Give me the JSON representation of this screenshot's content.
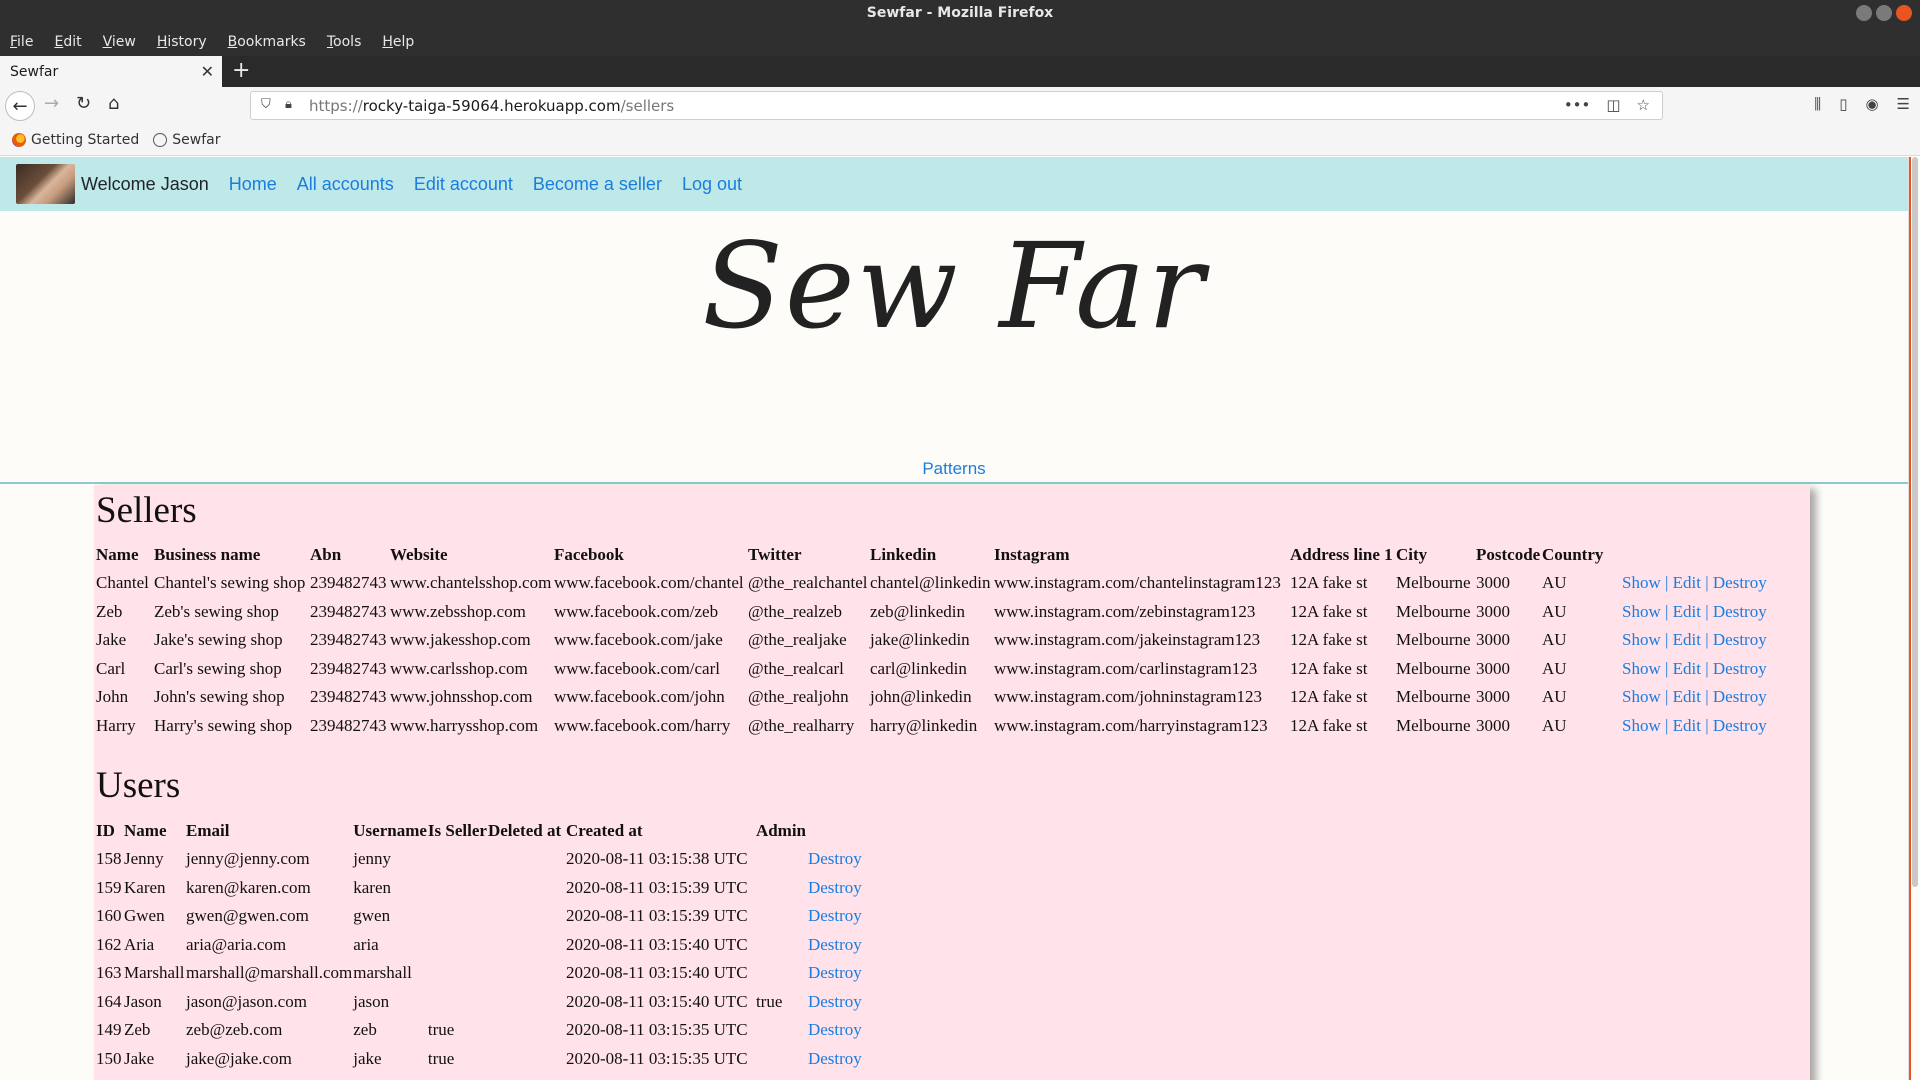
{
  "window": {
    "title": "Sewfar - Mozilla Firefox"
  },
  "menu": [
    "File",
    "Edit",
    "View",
    "History",
    "Bookmarks",
    "Tools",
    "Help"
  ],
  "tab": {
    "title": "Sewfar"
  },
  "url": {
    "prefix": "https://",
    "host": "rocky-taiga-59064.herokuapp.com",
    "path": "/sellers"
  },
  "bookmarks": [
    "Getting Started",
    "Sewfar"
  ],
  "site_nav": {
    "welcome": "Welcome Jason",
    "links": [
      "Home",
      "All accounts",
      "Edit account",
      "Become a seller",
      "Log out"
    ]
  },
  "brand": "Sew Far",
  "patterns_link": "Patterns",
  "sellers": {
    "heading": "Sellers",
    "columns": [
      "Name",
      "Business name",
      "Abn",
      "Website",
      "Facebook",
      "Twitter",
      "Linkedin",
      "Instagram",
      "Address line 1",
      "City",
      "Postcode",
      "Country"
    ],
    "actions": [
      "Show",
      "Edit",
      "Destroy"
    ],
    "rows": [
      [
        "Chantel",
        "Chantel's sewing shop",
        "239482743",
        "www.chantelsshop.com",
        "www.facebook.com/chantel",
        "@the_realchantel",
        "chantel@linkedin",
        "www.instagram.com/chantelinstagram123",
        "12A fake st",
        "Melbourne",
        "3000",
        "AU"
      ],
      [
        "Zeb",
        "Zeb's sewing shop",
        "239482743",
        "www.zebsshop.com",
        "www.facebook.com/zeb",
        "@the_realzeb",
        "zeb@linkedin",
        "www.instagram.com/zebinstagram123",
        "12A fake st",
        "Melbourne",
        "3000",
        "AU"
      ],
      [
        "Jake",
        "Jake's sewing shop",
        "239482743",
        "www.jakesshop.com",
        "www.facebook.com/jake",
        "@the_realjake",
        "jake@linkedin",
        "www.instagram.com/jakeinstagram123",
        "12A fake st",
        "Melbourne",
        "3000",
        "AU"
      ],
      [
        "Carl",
        "Carl's sewing shop",
        "239482743",
        "www.carlsshop.com",
        "www.facebook.com/carl",
        "@the_realcarl",
        "carl@linkedin",
        "www.instagram.com/carlinstagram123",
        "12A fake st",
        "Melbourne",
        "3000",
        "AU"
      ],
      [
        "John",
        "John's sewing shop",
        "239482743",
        "www.johnsshop.com",
        "www.facebook.com/john",
        "@the_realjohn",
        "john@linkedin",
        "www.instagram.com/johninstagram123",
        "12A fake st",
        "Melbourne",
        "3000",
        "AU"
      ],
      [
        "Harry",
        "Harry's sewing shop",
        "239482743",
        "www.harrysshop.com",
        "www.facebook.com/harry",
        "@the_realharry",
        "harry@linkedin",
        "www.instagram.com/harryinstagram123",
        "12A fake st",
        "Melbourne",
        "3000",
        "AU"
      ]
    ]
  },
  "users": {
    "heading": "Users",
    "columns": [
      "ID",
      "Name",
      "Email",
      "Username",
      "Is Seller",
      "Deleted at",
      "Created at",
      "Admin"
    ],
    "action": "Destroy",
    "rows": [
      [
        "158",
        "Jenny",
        "jenny@jenny.com",
        "jenny",
        "",
        "",
        "2020-08-11 03:15:38 UTC",
        ""
      ],
      [
        "159",
        "Karen",
        "karen@karen.com",
        "karen",
        "",
        "",
        "2020-08-11 03:15:39 UTC",
        ""
      ],
      [
        "160",
        "Gwen",
        "gwen@gwen.com",
        "gwen",
        "",
        "",
        "2020-08-11 03:15:39 UTC",
        ""
      ],
      [
        "162",
        "Aria",
        "aria@aria.com",
        "aria",
        "",
        "",
        "2020-08-11 03:15:40 UTC",
        ""
      ],
      [
        "163",
        "Marshall",
        "marshall@marshall.com",
        "marshall",
        "",
        "",
        "2020-08-11 03:15:40 UTC",
        ""
      ],
      [
        "164",
        "Jason",
        "jason@jason.com",
        "jason",
        "",
        "",
        "2020-08-11 03:15:40 UTC",
        "true"
      ],
      [
        "149",
        "Zeb",
        "zeb@zeb.com",
        "zeb",
        "true",
        "",
        "2020-08-11 03:15:35 UTC",
        ""
      ],
      [
        "150",
        "Jake",
        "jake@jake.com",
        "jake",
        "true",
        "",
        "2020-08-11 03:15:35 UTC",
        ""
      ]
    ]
  }
}
